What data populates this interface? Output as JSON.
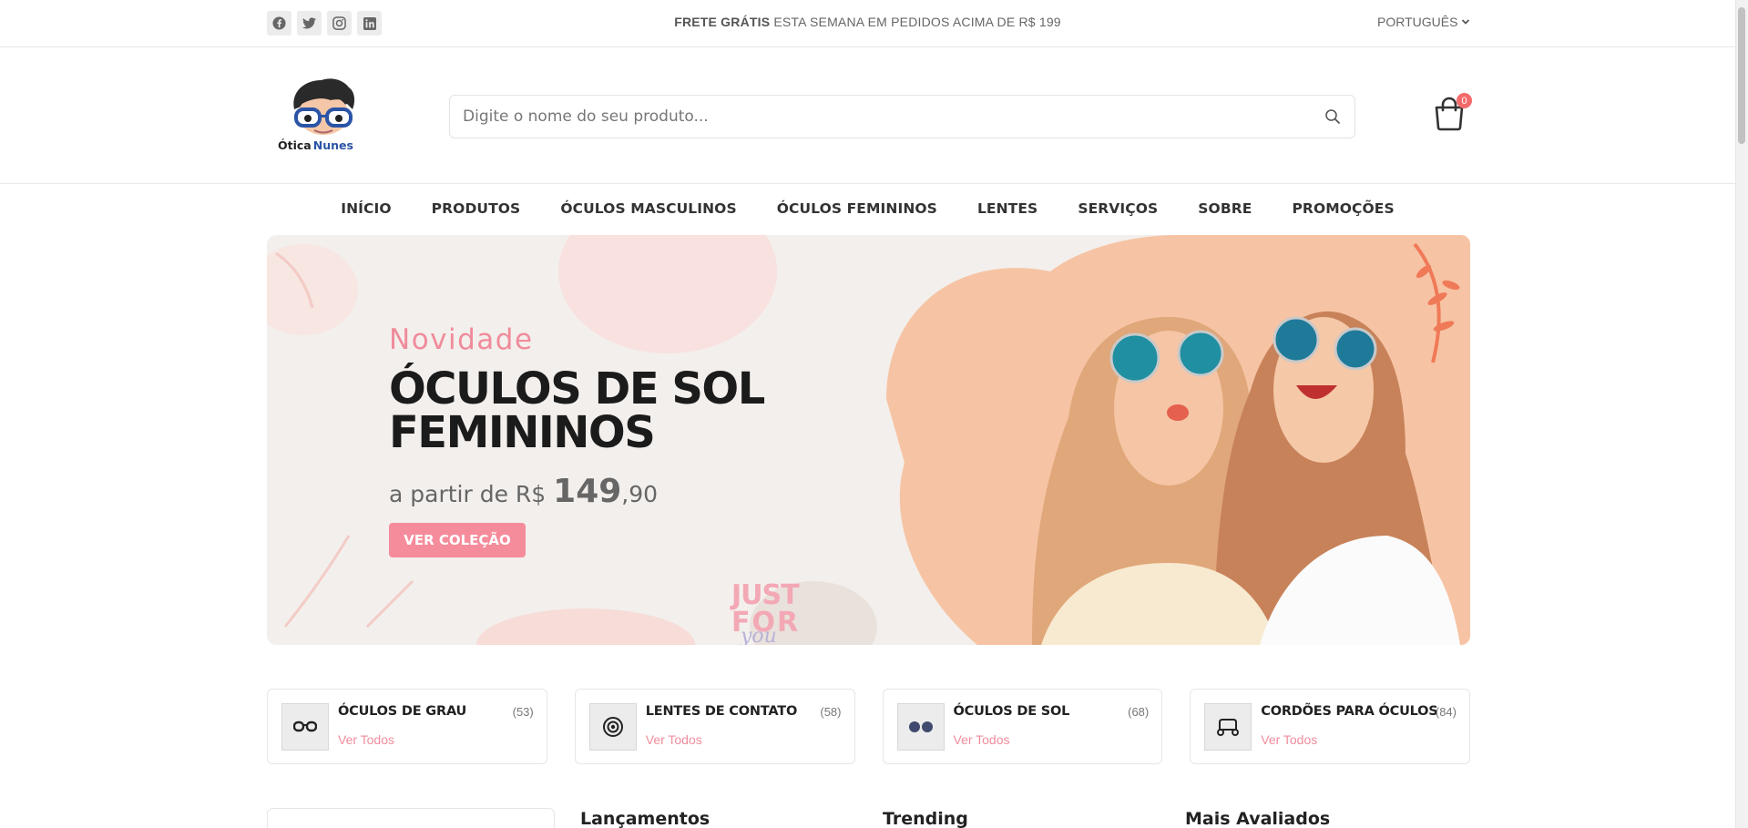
{
  "topbar": {
    "promo_bold": "FRETE GRÁTIS",
    "promo_rest": " ESTA SEMANA EM PEDIDOS ACIMA DE R$ 199",
    "language": "PORTUGUÊS",
    "social_icons": [
      "facebook-icon",
      "twitter-icon",
      "instagram-icon",
      "linkedin-icon"
    ]
  },
  "header": {
    "logo_text_1": "Ótica",
    "logo_text_2": "Nunes",
    "search_placeholder": "Digite o nome do seu produto...",
    "cart_count": "0"
  },
  "nav": {
    "items": [
      "INÍCIO",
      "PRODUTOS",
      "ÓCULOS MASCULINOS",
      "ÓCULOS FEMININOS",
      "LENTES",
      "SERVIÇOS",
      "SOBRE",
      "PROMOÇÕES"
    ]
  },
  "hero": {
    "kicker": "Novidade",
    "title": "ÓCULOS DE SOL FEMININOS",
    "price_prefix": "a partir de R$ ",
    "price_int": "149",
    "price_dec": ",90",
    "button": "VER COLEÇÃO",
    "deco_text_1": "JUST",
    "deco_text_2": "FOR",
    "deco_text_3": "you"
  },
  "categories": [
    {
      "title": "ÓCULOS DE GRAU",
      "count": "(53)",
      "link": "Ver Todos",
      "icon": "eyeglasses-icon"
    },
    {
      "title": "LENTES DE CONTATO",
      "count": "(58)",
      "link": "Ver Todos",
      "icon": "contact-lens-icon"
    },
    {
      "title": "ÓCULOS DE SOL",
      "count": "(68)",
      "link": "Ver Todos",
      "icon": "sunglasses-icon"
    },
    {
      "title": "CORDÕES PARA ÓCULOS",
      "count": "(84)",
      "link": "Ver Todos",
      "icon": "cord-icon"
    }
  ],
  "sections": {
    "launches": "Lançamentos",
    "trending": "Trending",
    "top_rated": "Mais Avaliados"
  },
  "colors": {
    "accent_pink": "#f58c9b",
    "badge_red": "#f36a6a",
    "logo_blue": "#2b54a6"
  }
}
